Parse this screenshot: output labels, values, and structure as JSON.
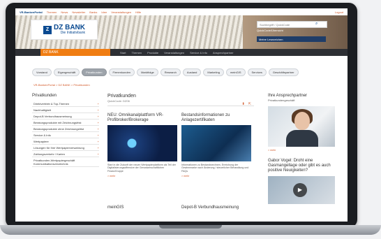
{
  "topbar": {
    "brand": "VR-BankenPortal",
    "links": [
      "Themen",
      "News",
      "Newsletter",
      "Banks",
      "Idee",
      "Veranstaltungen",
      "Hilfe"
    ],
    "logout": "Logout"
  },
  "logo": {
    "mark": "Z",
    "name": "DZ BANK",
    "tagline": "Die Initiativbank"
  },
  "search": {
    "placeholder": "Suchbegriff / QuickCode",
    "quickcode_label": "QuickCode/Übersicht",
    "login_dd": "Meine Lesezeichen"
  },
  "nav": {
    "dropdown": "DZ BANK",
    "items": [
      "Start",
      "Themen",
      "Produkte",
      "Veranstaltungen",
      "Service & Info",
      "Ansprechpartner"
    ]
  },
  "tabs": [
    "Vorstand",
    "Eigengeschäft",
    "Privatkunden",
    "Firmenkunden",
    "Marktfolge",
    "Research",
    "Ausland",
    "Marketing",
    "meinGIS",
    "Services",
    "Geschäftspartner"
  ],
  "active_tab": "Privatkunden",
  "breadcrumb": "VR-BankenPortal > DZ BANK > Privatkunden",
  "sidebar": {
    "title": "Privatkunden",
    "items": [
      "Direktvertrieb & Top-Themen",
      "Nachhaltigkeit",
      "Depot-B Verbundhausmeinung",
      "Beratungsprodukte mit Zeichnungsfrist",
      "Beratungsprodukte ohne Zeichnungsfrist",
      "Service & Info",
      "Wertpapiere",
      "Lösungen für Ihre Wertpapierverwahrung",
      "Zahlungsverkehr / Karten",
      "Privatkunden-Wertpapiergeschäft Kommunikationsverzeichnis"
    ]
  },
  "main": {
    "title": "Privatkunden",
    "quickcode": "QuickCode: DZ06",
    "article1": {
      "headline": "NEU: Omnikanalplattform VR-Profibroker/Brokerage",
      "text": "Start in die Zukunft der neuen Wertpapierplattform als Teil der Digitalisierungsoffensive der Genossenschaftlichen FinanzGruppe",
      "more": "> mehr"
    },
    "article2": {
      "headline": "Bestandsinformationen zu Anlagezertifikaten",
      "text": "Informationen zu Bestandsrechnen, Erreichung der Gewinnmarke nach Änderung / steuerlicher Behandlung und FAQs",
      "more": "> mehr"
    },
    "article3": {
      "headline": "meinGIS"
    },
    "article4": {
      "headline": "Depot-B Verbundhausmeinung"
    }
  },
  "right": {
    "title": "Ihre Ansprechpartner",
    "subtitle": "Privatkundengeschäft",
    "more": "> mehr",
    "teaser": "Gabor Vogel: Droht eine Gasmangellage oder gibt es auch positive Neuigkeiten?"
  }
}
